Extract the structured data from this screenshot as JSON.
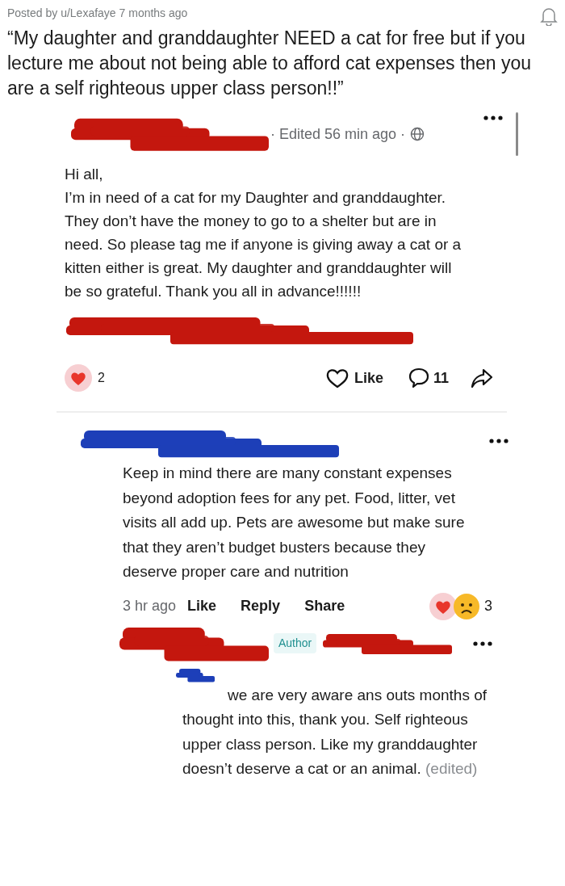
{
  "post_meta": "Posted by u/Lexafaye 7 months ago",
  "title": "“My daughter and granddaughter NEED a cat for free but if you lecture me about not being able to afford cat expenses then you are a self righteous upper class person!!”",
  "fb_post": {
    "edited": "· Edited 56 min ago ·",
    "body": [
      "Hi all,",
      "I’m in need of a cat for my Daughter and granddaughter. They don’t have the money to go to a shelter but are in need. So please tag me if anyone is giving away a cat or a kitten either is great. My daughter and granddaughter will be so grateful. Thank you all in advance!!!!!!"
    ],
    "reaction_count": "2",
    "like_label": "Like",
    "comment_count": "11"
  },
  "comment": {
    "text": "Keep in mind there are many constant expenses beyond adoption fees for any pet. Food, litter, vet visits all add up. Pets are awesome but make sure that they aren’t budget busters because they deserve proper care and nutrition",
    "time": "3 hr ago",
    "actions": [
      "Like",
      "Reply",
      "Share"
    ],
    "reaction_count": "3"
  },
  "reply": {
    "badge": "Author",
    "text": "we are very aware ans outs months of thought into this, thank you. Self righteous upper class person. Like my granddaughter doesn’t deserve a cat or an animal.",
    "edited_label": "(edited)"
  }
}
